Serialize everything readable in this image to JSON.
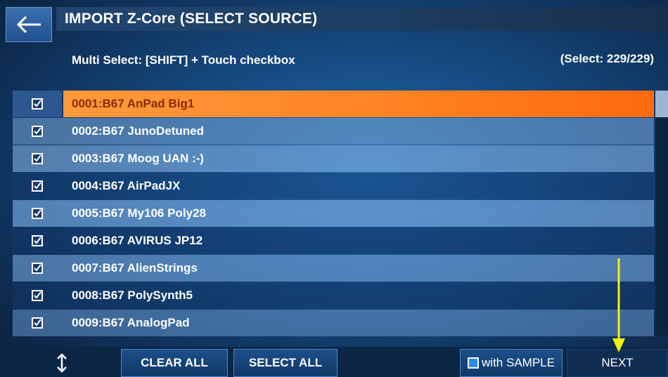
{
  "header": {
    "back_icon": "back-arrow-icon",
    "title": "IMPORT Z-Core (SELECT SOURCE)",
    "hint": "Multi Select: [SHIFT] + Touch checkbox",
    "select_count": "(Select: 229/229)"
  },
  "list": {
    "items": [
      {
        "label": "0001:B67 AnPad Big1",
        "checked": true,
        "selected": true
      },
      {
        "label": "0002:B67 JunoDetuned",
        "checked": true
      },
      {
        "label": "0003:B67 Moog UAN :-)",
        "checked": true
      },
      {
        "label": "0004:B67 AirPadJX",
        "checked": true
      },
      {
        "label": "0005:B67 My106 Poly28",
        "checked": true
      },
      {
        "label": "0006:B67 AVIRUS JP12",
        "checked": true
      },
      {
        "label": "0007:B67 AlienStrings",
        "checked": true
      },
      {
        "label": "0008:B67 PolySynth5",
        "checked": true
      },
      {
        "label": "0009:B67 AnalogPad",
        "checked": true
      }
    ]
  },
  "footer": {
    "sort_icon": "sort-updown-icon",
    "clear_all": "CLEAR ALL",
    "select_all": "SELECT ALL",
    "with_sample": "with SAMPLE",
    "next": "NEXT"
  },
  "colors": {
    "selected_row": "#ff8122",
    "annotation_arrow": "#f2f20a"
  }
}
